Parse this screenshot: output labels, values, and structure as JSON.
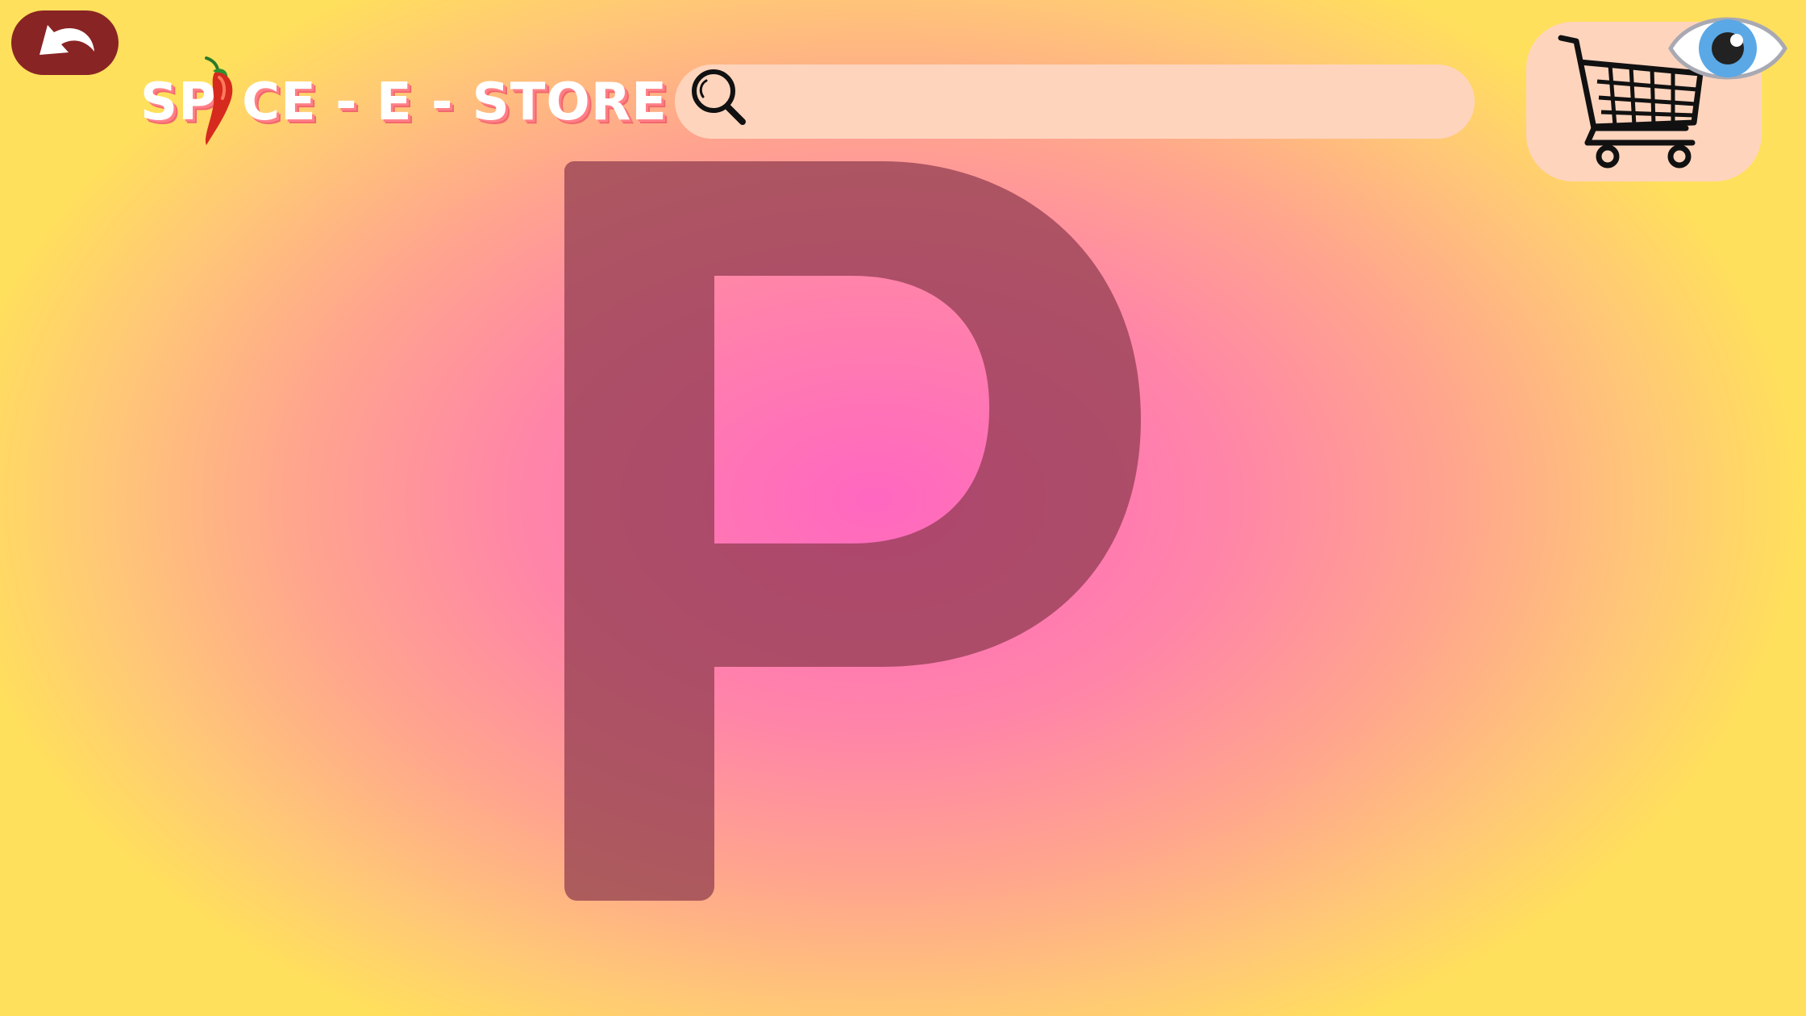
{
  "header": {
    "back_button": {
      "icon": "undo-arrow-icon"
    },
    "logo": {
      "text_left": "SP",
      "text_right": "CE - E - STORE",
      "icon": "chili-pepper-icon"
    },
    "search": {
      "icon": "search-icon",
      "placeholder": "",
      "value": ""
    },
    "cart": {
      "icon": "shopping-cart-icon",
      "overlay_icon": "eye-icon"
    }
  },
  "main": {
    "category_letter": "P"
  },
  "colors": {
    "back_button": "#892424",
    "search_bg": "#ffd4bd",
    "letter": "#8e3a4e",
    "gradient_center": "#ff67c0",
    "gradient_edge": "#ffe05c"
  }
}
